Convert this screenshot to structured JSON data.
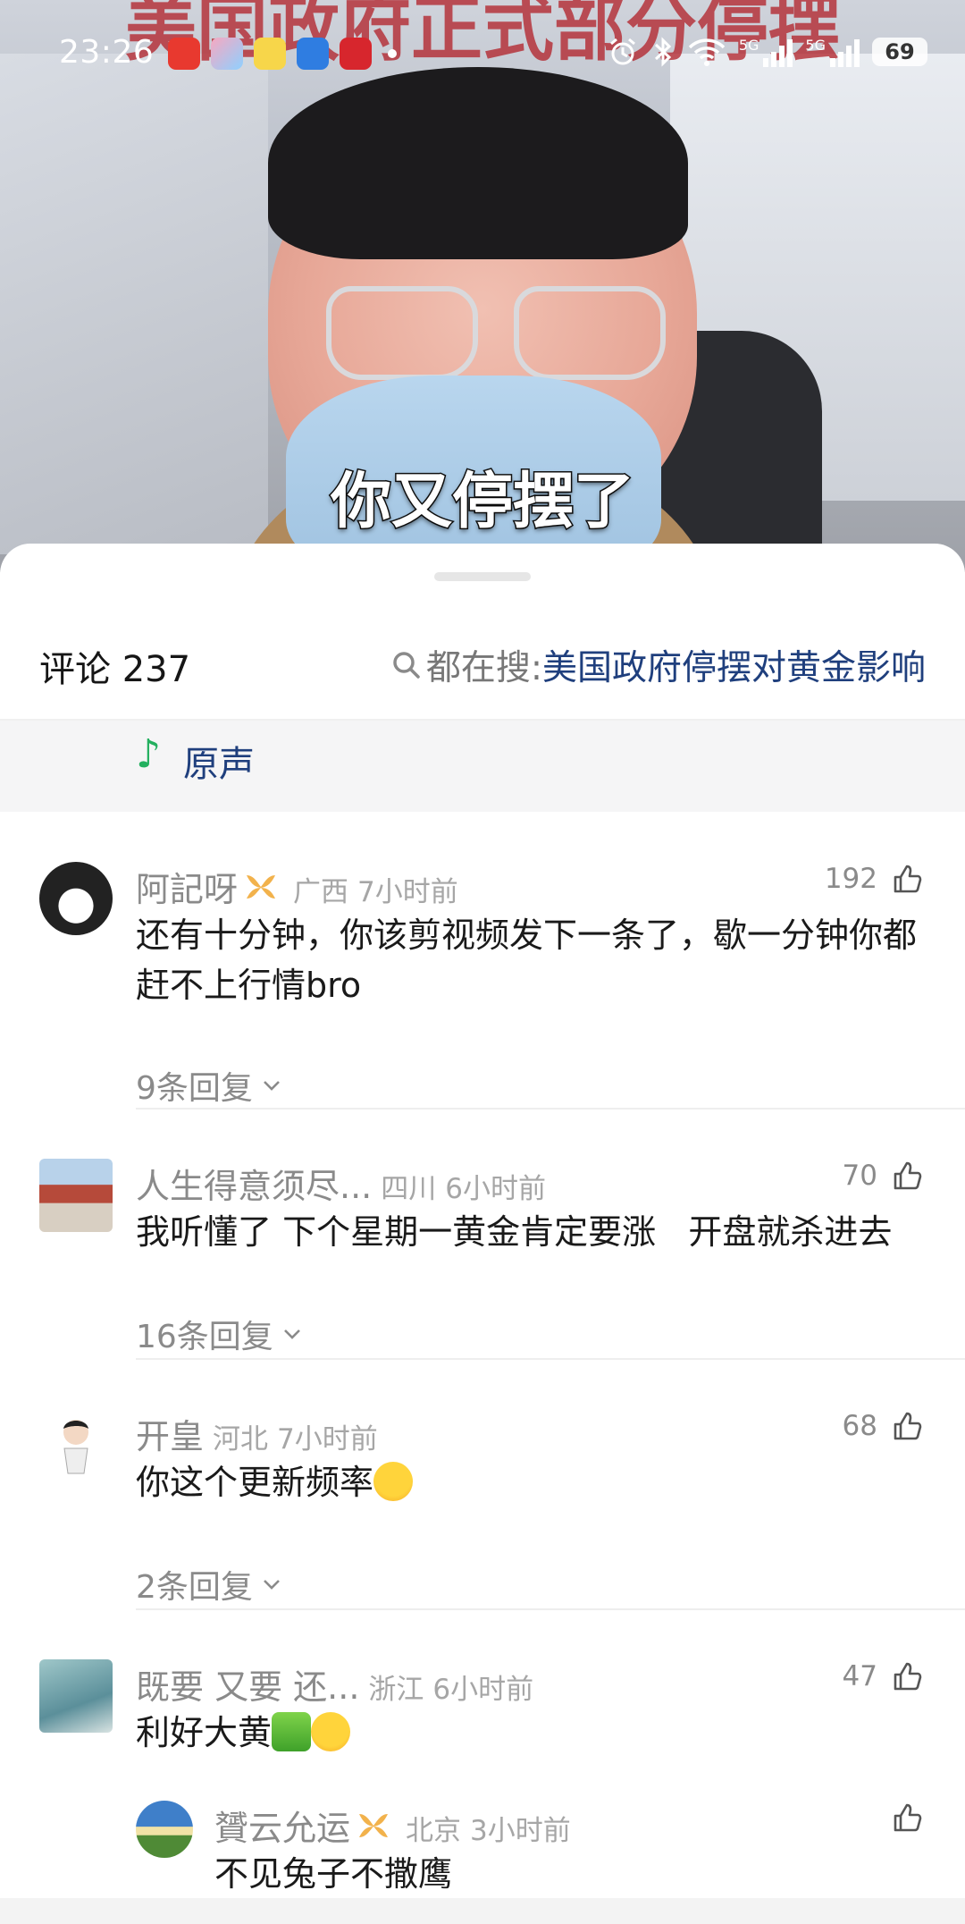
{
  "status_bar": {
    "time": "23:26",
    "network_1": "5G",
    "network_2": "5G",
    "battery": "69"
  },
  "video": {
    "headline": "美国政府正式部分停摆",
    "subtitle": "你又停摆了"
  },
  "comments_panel": {
    "title": "评论 237",
    "search_label": "都在搜: ",
    "search_query": "美国政府停摆对黄金影响",
    "music_label": "原声",
    "comments": [
      {
        "name": "阿記呀",
        "region": "广西",
        "time": "7小时前",
        "likes": "192",
        "text": "还有十分钟，你该剪视频发下一条了，歇一分钟你都赶不上行情bro",
        "replies": "9条回复"
      },
      {
        "name": "人生得意须尽...",
        "region": "四川",
        "time": "6小时前",
        "likes": "70",
        "text": "我听懂了 下个星期一黄金肯定要涨   开盘就杀进去",
        "replies": "16条回复"
      },
      {
        "name": "开皇",
        "region": "河北",
        "time": "7小时前",
        "likes": "68",
        "text": "你这个更新频率",
        "replies": "2条回复"
      },
      {
        "name": "既要 又要 还...",
        "region": "浙江",
        "time": "6小时前",
        "likes": "47",
        "text": "利好大黄"
      }
    ],
    "reply": {
      "name": "贇云允运",
      "region": "北京",
      "time": "3小时前",
      "text": "不见兔子不撒鹰"
    }
  },
  "colors": {
    "link_blue": "#1f3f7d",
    "music_green": "#23b05f",
    "headline_red": "#b3262e"
  }
}
